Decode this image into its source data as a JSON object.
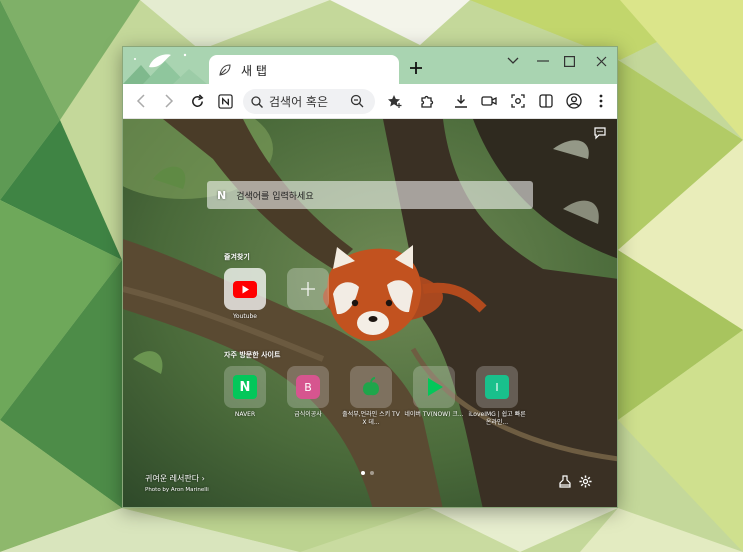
{
  "colors": {
    "titlebar": "#a9d4b1",
    "accent_green": "#03c75a",
    "youtube_red": "#ff0000",
    "pink_tile": "#d6558f",
    "teal_tile": "#19c08c"
  },
  "tab": {
    "title": "새 탭",
    "icon": "leaf-icon"
  },
  "omnibox": {
    "text": "검색어 혹은"
  },
  "search": {
    "placeholder": "검색어를 입력하세요",
    "logo": "N"
  },
  "favorites": {
    "label": "즐겨찾기",
    "items": [
      {
        "label": "Youtube",
        "icon": "youtube-icon"
      },
      {
        "label": "",
        "icon": "plus-icon"
      }
    ]
  },
  "frequent": {
    "label": "자주 방문한 사이트",
    "items": [
      {
        "label": "NAVER",
        "letter": "N"
      },
      {
        "label": "급식이공사",
        "letter": "B"
      },
      {
        "label": "출석부,언라인 스키 TV X 데...",
        "letter": ""
      },
      {
        "label": "네이버 TV(NOW) 크...",
        "letter": ""
      },
      {
        "label": "iLoveIMG | 쉽고 빠른 온라인...",
        "letter": "I"
      }
    ]
  },
  "credit": {
    "title": "귀여운 레서판다",
    "photo": "Photo by Aron Marinelli"
  }
}
